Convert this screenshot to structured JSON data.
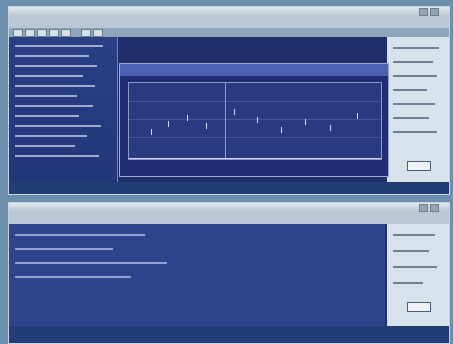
{
  "top_window": {
    "title": "",
    "controls": [
      "",
      "",
      ""
    ],
    "menu": [
      "",
      "",
      "",
      "",
      "",
      ""
    ],
    "status": [
      "",
      "",
      ""
    ],
    "right_panel": [
      "",
      "",
      "",
      "",
      "",
      "",
      ""
    ]
  },
  "bottom_window": {
    "title": "",
    "controls": [
      "",
      "",
      ""
    ],
    "menu": [
      "",
      "",
      "",
      ""
    ],
    "status": [
      "",
      ""
    ],
    "content": [
      "",
      "",
      "",
      ""
    ],
    "right_panel": [
      "",
      "",
      "",
      ""
    ]
  },
  "colors": {
    "background": "#6d8fae",
    "window_blue": "#1f2f6c",
    "panel_light": "#d8e2ea",
    "status_bar": "#223d75"
  }
}
